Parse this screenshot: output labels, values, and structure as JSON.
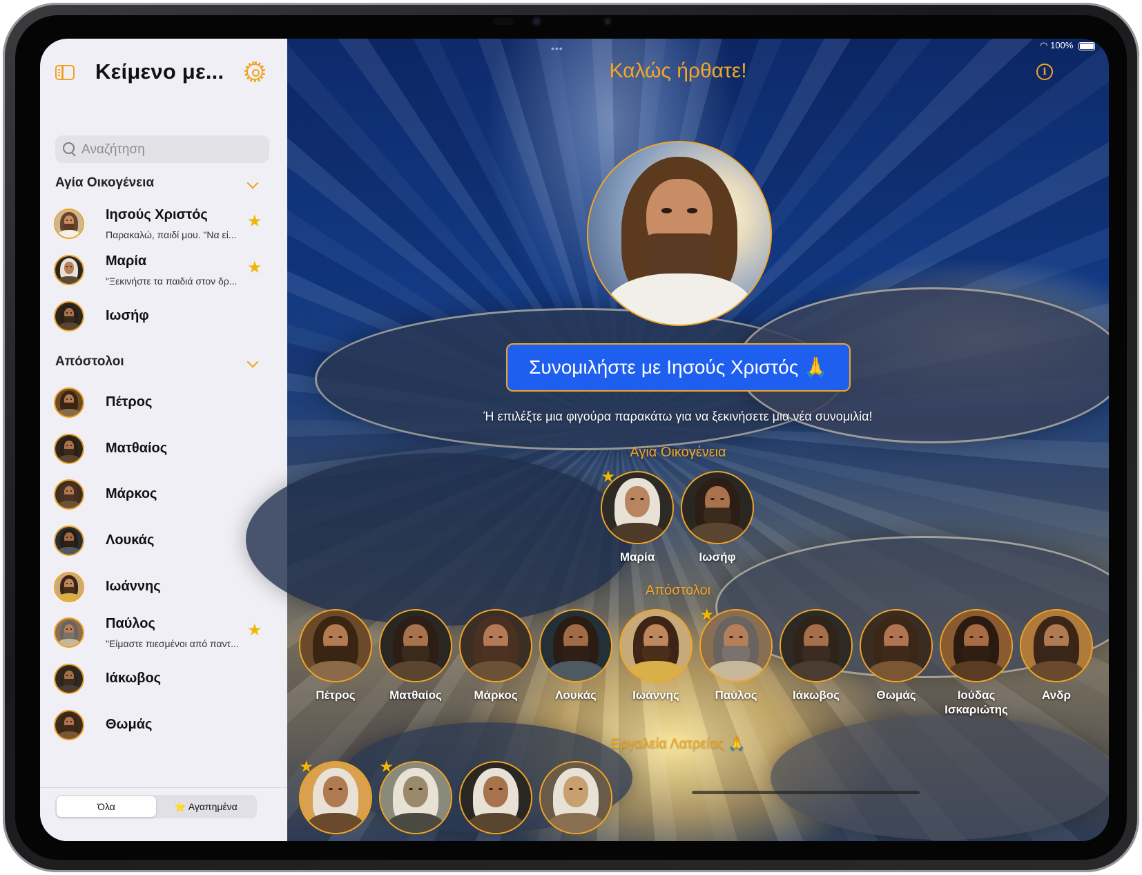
{
  "sidebar": {
    "title": "Κείμενο με...",
    "search_placeholder": "Αναζήτηση",
    "sections": [
      {
        "title": "Αγία Οικογένεια",
        "items": [
          {
            "name": "Ιησούς Χριστός",
            "preview": "Παρακαλώ, παιδί μου. \"Να εί...",
            "favorite": true
          },
          {
            "name": "Μαρία",
            "preview": "\"Ξεκινήστε τα παιδιά στον δρ...",
            "favorite": true
          },
          {
            "name": "Ιωσήφ",
            "preview": "",
            "favorite": false
          }
        ]
      },
      {
        "title": "Απόστολοι",
        "items": [
          {
            "name": "Πέτρος",
            "preview": "",
            "favorite": false
          },
          {
            "name": "Ματθαίος",
            "preview": "",
            "favorite": false
          },
          {
            "name": "Μάρκος",
            "preview": "",
            "favorite": false
          },
          {
            "name": "Λουκάς",
            "preview": "",
            "favorite": false
          },
          {
            "name": "Ιωάννης",
            "preview": "",
            "favorite": false
          },
          {
            "name": "Παύλος",
            "preview": "\"Είμαστε πιεσμένοι από παντ...",
            "favorite": true
          },
          {
            "name": "Ιάκωβος",
            "preview": "",
            "favorite": false
          },
          {
            "name": "Θωμάς",
            "preview": "",
            "favorite": false
          }
        ]
      }
    ],
    "segments": {
      "all": "Όλα",
      "favorites": "⭐ Αγαπημένα"
    }
  },
  "status_bar": {
    "battery": "100%"
  },
  "main": {
    "welcome": "Καλώς ήρθατε!",
    "chat_button": "Συνομιλήστε με Ιησούς Χριστός 🙏",
    "lead": "Ή επιλέξτε μια φιγούρα παρακάτω για να ξεκινήσετε μια νέα συνομιλία!",
    "holy_family_title": "Αγία Οικογένεια",
    "holy_family": [
      {
        "name": "Μαρία",
        "favorite": true
      },
      {
        "name": "Ιωσήφ",
        "favorite": false
      }
    ],
    "apostles_title": "Απόστολοι",
    "apostles": [
      {
        "name": "Πέτρος",
        "favorite": false
      },
      {
        "name": "Ματθαίος",
        "favorite": false
      },
      {
        "name": "Μάρκος",
        "favorite": false
      },
      {
        "name": "Λουκάς",
        "favorite": false
      },
      {
        "name": "Ιωάννης",
        "favorite": false
      },
      {
        "name": "Παύλος",
        "favorite": true
      },
      {
        "name": "Ιάκωβος",
        "favorite": false
      },
      {
        "name": "Θωμάς",
        "favorite": false
      },
      {
        "name": "Ιούδας Ισκαριώτης",
        "favorite": false
      },
      {
        "name": "Ανδρ",
        "favorite": false
      }
    ],
    "worship_title": "Εργαλεία Λατρείας 🙏"
  },
  "colors": {
    "accent": "#f5a623",
    "button": "#1e5ff0",
    "star": "#f2b705"
  }
}
